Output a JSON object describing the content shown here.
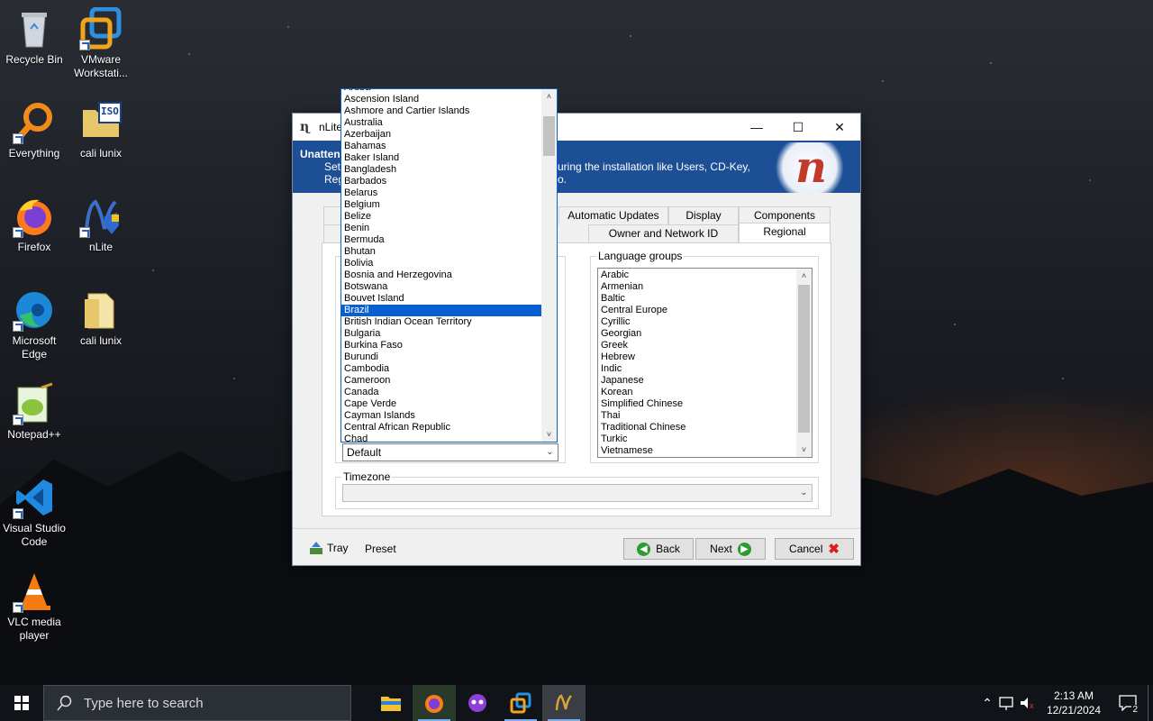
{
  "desktop": {
    "icons": [
      {
        "name": "Recycle Bin"
      },
      {
        "name": "VMware Workstati..."
      },
      {
        "name": "Everything"
      },
      {
        "name": "cali lunix"
      },
      {
        "name": "Firefox"
      },
      {
        "name": "nLite"
      },
      {
        "name": "Microsoft Edge"
      },
      {
        "name": "cali lunix"
      },
      {
        "name": "Notepad++"
      },
      {
        "name": "Visual Studio Code"
      },
      {
        "name": "VLC media player"
      }
    ],
    "iso_badge": "ISO"
  },
  "window": {
    "title": "nLite",
    "header": {
      "title": "Unattended",
      "subtitle1_left": "Set",
      "subtitle1_right": "uring the installation like Users, CD-Key,",
      "subtitle2_left": "Reg",
      "subtitle2_right": "o."
    },
    "tabs_row1": [
      "Automatic Updates",
      "Display",
      "Components"
    ],
    "tabs_row2": [
      "Owner and Network ID",
      "Regional"
    ],
    "active_tab": "Regional",
    "language_groups": {
      "label": "Language groups",
      "items": [
        "Arabic",
        "Armenian",
        "Baltic",
        "Central Europe",
        "Cyrillic",
        "Georgian",
        "Greek",
        "Hebrew",
        "Indic",
        "Japanese",
        "Korean",
        "Simplified Chinese",
        "Thai",
        "Traditional Chinese",
        "Turkic",
        "Vietnamese"
      ]
    },
    "location_combo": {
      "value": "Default"
    },
    "timezone": {
      "label": "Timezone",
      "value": ""
    },
    "footer": {
      "tray": "Tray",
      "preset": "Preset",
      "back": "Back",
      "next": "Next",
      "cancel": "Cancel"
    }
  },
  "dropdown": {
    "items": [
      "Aruba",
      "Ascension Island",
      "Ashmore and Cartier Islands",
      "Australia",
      "Azerbaijan",
      "Bahamas",
      "Baker Island",
      "Bangladesh",
      "Barbados",
      "Belarus",
      "Belgium",
      "Belize",
      "Benin",
      "Bermuda",
      "Bhutan",
      "Bolivia",
      "Bosnia and Herzegovina",
      "Botswana",
      "Bouvet Island",
      "Brazil",
      "British Indian Ocean Territory",
      "Bulgaria",
      "Burkina Faso",
      "Burundi",
      "Cambodia",
      "Cameroon",
      "Canada",
      "Cape Verde",
      "Cayman Islands",
      "Central African Republic",
      "Chad"
    ],
    "selected": "Brazil"
  },
  "taskbar": {
    "search_placeholder": "Type here to search",
    "time": "2:13 AM",
    "date": "12/21/2024",
    "notification_count": "2"
  }
}
